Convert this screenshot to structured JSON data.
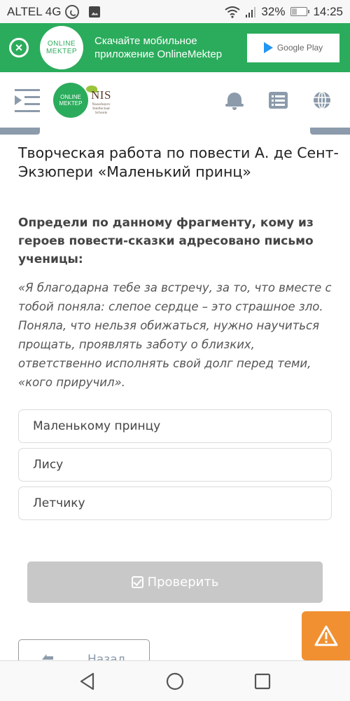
{
  "status_bar": {
    "carrier": "ALTEL 4G",
    "battery": "32%",
    "time": "14:25"
  },
  "banner": {
    "logo_line1": "ONLINE",
    "logo_line2": "MEKTEP",
    "text": "Скачайте мобильное приложение OnlineMektep",
    "store_label": "Google Play",
    "colors": {
      "background": "#2bac5c"
    }
  },
  "header": {
    "logo_line1": "ONLINE",
    "logo_line2": "MEKTEP",
    "nis_title": "NIS",
    "nis_subtitle_1": "Nazarbayev",
    "nis_subtitle_2": "Intellectual",
    "nis_subtitle_3": "Schools"
  },
  "main": {
    "title": "Творческая работа по повести А. де Сент-Экзюпери «Маленький принц»",
    "question": "Определи по данному фрагменту, кому из героев повести-сказки адресовано письмо ученицы:",
    "quote": "«Я благодарна тебе за встречу, за то, что вместе с тобой поняла: слепое сердце – это страшное зло. Поняла, что нельзя обижаться, нужно научиться прощать, проявлять заботу о близких, ответственно исполнять свой долг перед теми, «кого приручил».",
    "options": [
      {
        "label": "Маленькому принцу"
      },
      {
        "label": "Лису"
      },
      {
        "label": "Летчику"
      }
    ],
    "check_button": "Проверить",
    "back_button": "Назад"
  },
  "colors": {
    "accent_green": "#2bac5c",
    "icon_gray": "#8c9bab",
    "warning_orange": "#f19031",
    "disabled_button": "#c8c8c8"
  }
}
